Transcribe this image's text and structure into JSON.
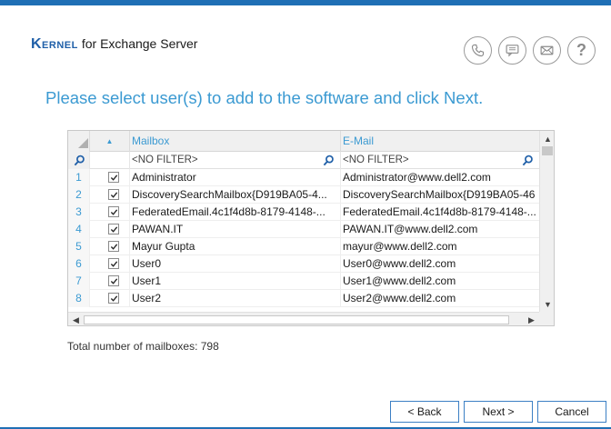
{
  "brand": {
    "kernel": "Kernel",
    "rest": "for Exchange Server"
  },
  "top_icons": [
    "phone-icon",
    "chat-icon",
    "mail-icon",
    "help-icon"
  ],
  "help_glyph": "?",
  "heading": "Please select user(s) to add to the software and click Next.",
  "grid": {
    "columns": {
      "sort_indicator": "▲",
      "mailbox": "Mailbox",
      "email": "E-Mail"
    },
    "filter": {
      "mailbox": "<NO FILTER>",
      "email": "<NO FILTER>"
    },
    "rows": [
      {
        "num": "1",
        "checked": true,
        "mailbox": "Administrator",
        "email": "Administrator@www.dell2.com"
      },
      {
        "num": "2",
        "checked": true,
        "mailbox": "DiscoverySearchMailbox{D919BA05-4...",
        "email": "DiscoverySearchMailbox{D919BA05-46"
      },
      {
        "num": "3",
        "checked": true,
        "mailbox": "FederatedEmail.4c1f4d8b-8179-4148-...",
        "email": "FederatedEmail.4c1f4d8b-8179-4148-..."
      },
      {
        "num": "4",
        "checked": true,
        "mailbox": "PAWAN.IT",
        "email": "PAWAN.IT@www.dell2.com"
      },
      {
        "num": "5",
        "checked": true,
        "mailbox": "Mayur Gupta",
        "email": "mayur@www.dell2.com"
      },
      {
        "num": "6",
        "checked": true,
        "mailbox": "User0",
        "email": "User0@www.dell2.com"
      },
      {
        "num": "7",
        "checked": true,
        "mailbox": "User1",
        "email": "User1@www.dell2.com"
      },
      {
        "num": "8",
        "checked": true,
        "mailbox": "User2",
        "email": "User2@www.dell2.com"
      }
    ]
  },
  "total": "Total number of mailboxes: 798",
  "buttons": {
    "back": "< Back",
    "next": "Next >",
    "cancel": "Cancel"
  },
  "colors": {
    "accent": "#1f6fb5",
    "heading": "#3b9ad2"
  }
}
